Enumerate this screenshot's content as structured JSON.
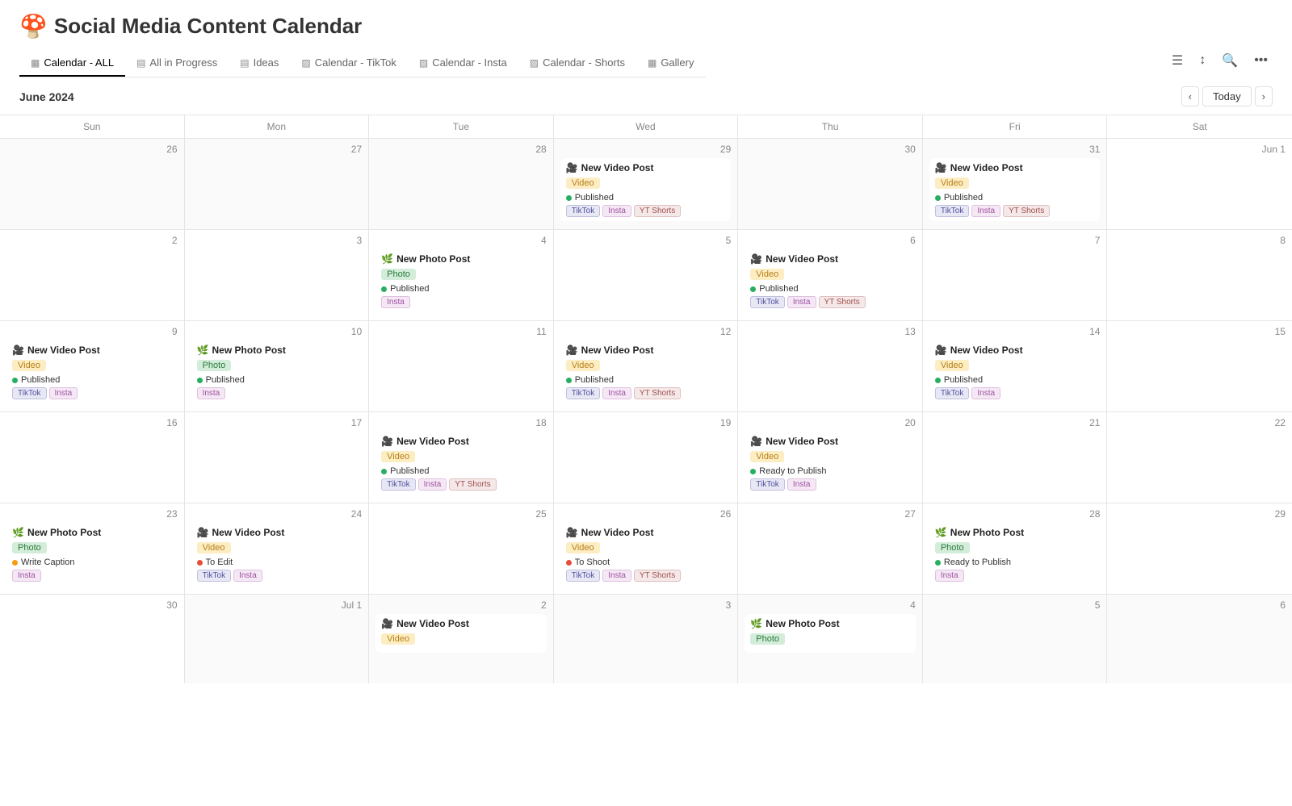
{
  "app": {
    "emoji": "🍄",
    "title": "Social Media Content Calendar"
  },
  "nav": {
    "tabs": [
      {
        "id": "calendar-all",
        "icon": "▦",
        "label": "Calendar - ALL",
        "active": true
      },
      {
        "id": "all-in-progress",
        "icon": "▤",
        "label": "All in Progress",
        "active": false
      },
      {
        "id": "ideas",
        "icon": "▤",
        "label": "Ideas",
        "active": false
      },
      {
        "id": "calendar-tiktok",
        "icon": "▨",
        "label": "Calendar - TikTok",
        "active": false
      },
      {
        "id": "calendar-insta",
        "icon": "▨",
        "label": "Calendar - Insta",
        "active": false
      },
      {
        "id": "calendar-shorts",
        "icon": "▨",
        "label": "Calendar - Shorts",
        "active": false
      },
      {
        "id": "gallery",
        "icon": "▦",
        "label": "Gallery",
        "active": false
      }
    ]
  },
  "calendar": {
    "month": "June 2024",
    "today_label": "Today",
    "day_headers": [
      "Sun",
      "Mon",
      "Tue",
      "Wed",
      "Thu",
      "Fri",
      "Sat"
    ],
    "weeks": [
      {
        "days": [
          {
            "date": "26",
            "other_month": true,
            "events": []
          },
          {
            "date": "27",
            "other_month": true,
            "events": []
          },
          {
            "date": "28",
            "other_month": true,
            "events": []
          },
          {
            "date": "29",
            "other_month": true,
            "events": [
              {
                "emoji": "🎥",
                "title": "New Video Post",
                "type_tag": "Video",
                "type_class": "tag-video",
                "status": "Published",
                "status_class": "dot-published",
                "platforms": [
                  {
                    "label": "TikTok",
                    "class": "pt-tiktok"
                  },
                  {
                    "label": "Insta",
                    "class": "pt-insta"
                  },
                  {
                    "label": "YT Shorts",
                    "class": "pt-ytshorts"
                  }
                ]
              }
            ]
          },
          {
            "date": "30",
            "other_month": true,
            "events": []
          },
          {
            "date": "31",
            "other_month": true,
            "events": [
              {
                "emoji": "🎥",
                "title": "New Video Post",
                "type_tag": "Video",
                "type_class": "tag-video",
                "status": "Published",
                "status_class": "dot-published",
                "platforms": [
                  {
                    "label": "TikTok",
                    "class": "pt-tiktok"
                  },
                  {
                    "label": "Insta",
                    "class": "pt-insta"
                  },
                  {
                    "label": "YT Shorts",
                    "class": "pt-ytshorts"
                  }
                ]
              }
            ]
          },
          {
            "date": "Jun 1",
            "other_month": false,
            "events": []
          }
        ]
      },
      {
        "days": [
          {
            "date": "2",
            "other_month": false,
            "events": []
          },
          {
            "date": "3",
            "other_month": false,
            "events": []
          },
          {
            "date": "4",
            "other_month": false,
            "events": [
              {
                "emoji": "🌿",
                "title": "New Photo Post",
                "type_tag": "Photo",
                "type_class": "tag-photo",
                "status": "Published",
                "status_class": "dot-published",
                "platforms": [
                  {
                    "label": "Insta",
                    "class": "pt-insta"
                  }
                ]
              }
            ]
          },
          {
            "date": "5",
            "other_month": false,
            "events": []
          },
          {
            "date": "6",
            "other_month": false,
            "events": [
              {
                "emoji": "🎥",
                "title": "New Video Post",
                "type_tag": "Video",
                "type_class": "tag-video",
                "status": "Published",
                "status_class": "dot-published",
                "platforms": [
                  {
                    "label": "TikTok",
                    "class": "pt-tiktok"
                  },
                  {
                    "label": "Insta",
                    "class": "pt-insta"
                  },
                  {
                    "label": "YT Shorts",
                    "class": "pt-ytshorts"
                  }
                ]
              }
            ]
          },
          {
            "date": "7",
            "other_month": false,
            "events": []
          },
          {
            "date": "8",
            "other_month": false,
            "events": []
          }
        ]
      },
      {
        "days": [
          {
            "date": "9",
            "other_month": false,
            "events": [
              {
                "emoji": "🎥",
                "title": "New Video Post",
                "type_tag": "Video",
                "type_class": "tag-video",
                "status": "Published",
                "status_class": "dot-published",
                "platforms": [
                  {
                    "label": "TikTok",
                    "class": "pt-tiktok"
                  },
                  {
                    "label": "Insta",
                    "class": "pt-insta"
                  }
                ]
              }
            ]
          },
          {
            "date": "10",
            "other_month": false,
            "events": [
              {
                "emoji": "🌿",
                "title": "New Photo Post",
                "type_tag": "Photo",
                "type_class": "tag-photo",
                "status": "Published",
                "status_class": "dot-published",
                "platforms": [
                  {
                    "label": "Insta",
                    "class": "pt-insta"
                  }
                ]
              }
            ]
          },
          {
            "date": "11",
            "other_month": false,
            "events": []
          },
          {
            "date": "12",
            "other_month": false,
            "events": [
              {
                "emoji": "🎥",
                "title": "New Video Post",
                "type_tag": "Video",
                "type_class": "tag-video",
                "status": "Published",
                "status_class": "dot-published",
                "platforms": [
                  {
                    "label": "TikTok",
                    "class": "pt-tiktok"
                  },
                  {
                    "label": "Insta",
                    "class": "pt-insta"
                  },
                  {
                    "label": "YT Shorts",
                    "class": "pt-ytshorts"
                  }
                ]
              }
            ]
          },
          {
            "date": "13",
            "other_month": false,
            "events": []
          },
          {
            "date": "14",
            "other_month": false,
            "events": [
              {
                "emoji": "🎥",
                "title": "New Video Post",
                "type_tag": "Video",
                "type_class": "tag-video",
                "status": "Published",
                "status_class": "dot-published",
                "platforms": [
                  {
                    "label": "TikTok",
                    "class": "pt-tiktok"
                  },
                  {
                    "label": "Insta",
                    "class": "pt-insta"
                  }
                ]
              }
            ]
          },
          {
            "date": "15",
            "other_month": false,
            "events": []
          }
        ]
      },
      {
        "days": [
          {
            "date": "16",
            "other_month": false,
            "events": []
          },
          {
            "date": "17",
            "other_month": false,
            "events": []
          },
          {
            "date": "18",
            "other_month": false,
            "events": [
              {
                "emoji": "🎥",
                "title": "New Video Post",
                "type_tag": "Video",
                "type_class": "tag-video",
                "status": "Published",
                "status_class": "dot-published",
                "platforms": [
                  {
                    "label": "TikTok",
                    "class": "pt-tiktok"
                  },
                  {
                    "label": "Insta",
                    "class": "pt-insta"
                  },
                  {
                    "label": "YT Shorts",
                    "class": "pt-ytshorts"
                  }
                ]
              }
            ]
          },
          {
            "date": "19",
            "other_month": false,
            "events": []
          },
          {
            "date": "20",
            "other_month": false,
            "events": [
              {
                "emoji": "🎥",
                "title": "New Video Post",
                "type_tag": "Video",
                "type_class": "tag-video",
                "status": "Ready to Publish",
                "status_class": "dot-ready",
                "platforms": [
                  {
                    "label": "TikTok",
                    "class": "pt-tiktok"
                  },
                  {
                    "label": "Insta",
                    "class": "pt-insta"
                  }
                ]
              }
            ]
          },
          {
            "date": "21",
            "other_month": false,
            "events": []
          },
          {
            "date": "22",
            "other_month": false,
            "events": []
          }
        ]
      },
      {
        "days": [
          {
            "date": "23",
            "other_month": false,
            "events": [
              {
                "emoji": "🌿",
                "title": "New Photo Post",
                "type_tag": "Photo",
                "type_class": "tag-photo",
                "status": "Write Caption",
                "status_class": "dot-write",
                "platforms": [
                  {
                    "label": "Insta",
                    "class": "pt-insta"
                  }
                ]
              }
            ]
          },
          {
            "date": "24",
            "other_month": false,
            "events": [
              {
                "emoji": "🎥",
                "title": "New Video Post",
                "type_tag": "Video",
                "type_class": "tag-video",
                "status": "To Edit",
                "status_class": "dot-edit",
                "platforms": [
                  {
                    "label": "TikTok",
                    "class": "pt-tiktok"
                  },
                  {
                    "label": "Insta",
                    "class": "pt-insta"
                  }
                ]
              }
            ]
          },
          {
            "date": "25",
            "other_month": false,
            "events": []
          },
          {
            "date": "26",
            "other_month": false,
            "today": true,
            "events": [
              {
                "emoji": "🎥",
                "title": "New Video Post",
                "type_tag": "Video",
                "type_class": "tag-video",
                "status": "To Shoot",
                "status_class": "dot-shoot",
                "platforms": [
                  {
                    "label": "TikTok",
                    "class": "pt-tiktok"
                  },
                  {
                    "label": "Insta",
                    "class": "pt-insta"
                  },
                  {
                    "label": "YT Shorts",
                    "class": "pt-ytshorts"
                  }
                ]
              }
            ]
          },
          {
            "date": "27",
            "other_month": false,
            "events": []
          },
          {
            "date": "28",
            "other_month": false,
            "events": [
              {
                "emoji": "🌿",
                "title": "New Photo Post",
                "type_tag": "Photo",
                "type_class": "tag-photo",
                "status": "Ready to Publish",
                "status_class": "dot-ready",
                "platforms": [
                  {
                    "label": "Insta",
                    "class": "pt-insta"
                  }
                ]
              }
            ]
          },
          {
            "date": "29",
            "other_month": false,
            "events": []
          }
        ]
      },
      {
        "days": [
          {
            "date": "30",
            "other_month": false,
            "events": []
          },
          {
            "date": "Jul 1",
            "other_month": true,
            "events": []
          },
          {
            "date": "2",
            "other_month": true,
            "events": [
              {
                "emoji": "🎥",
                "title": "New Video Post",
                "type_tag": "Video",
                "type_class": "tag-video",
                "status": null,
                "status_class": null,
                "platforms": []
              }
            ]
          },
          {
            "date": "3",
            "other_month": true,
            "events": []
          },
          {
            "date": "4",
            "other_month": true,
            "events": [
              {
                "emoji": "🌿",
                "title": "New Photo Post",
                "type_tag": "Photo",
                "type_class": "tag-photo",
                "status": null,
                "status_class": null,
                "platforms": []
              }
            ]
          },
          {
            "date": "5",
            "other_month": true,
            "events": []
          },
          {
            "date": "6",
            "other_month": true,
            "events": []
          }
        ]
      }
    ]
  }
}
